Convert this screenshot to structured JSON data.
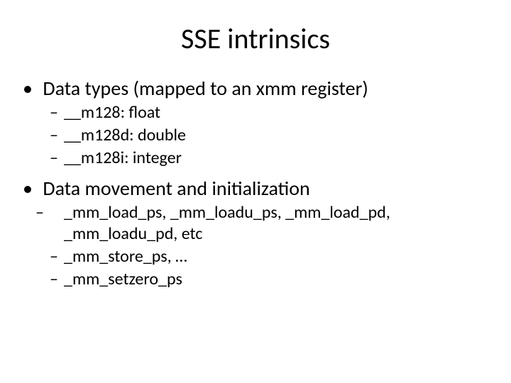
{
  "title": "SSE intrinsics",
  "bullets": {
    "b1": {
      "label": "Data types (mapped to an xmm register)",
      "sub": {
        "s1": "__m128: float",
        "s2": "__m128d: double",
        "s3": "__m128i: integer"
      }
    },
    "b2": {
      "label": "Data movement and initialization",
      "sub": {
        "s1": "_mm_load_ps, _mm_loadu_ps, _mm_load_pd, _mm_loadu_pd, etc",
        "s2": "_mm_store_ps, …",
        "s3": "_mm_setzero_ps"
      }
    }
  }
}
